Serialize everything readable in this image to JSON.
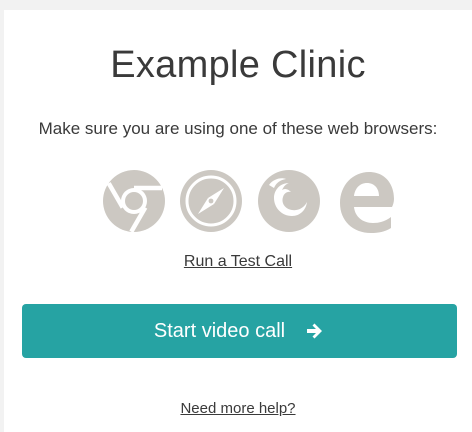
{
  "clinic": {
    "title": "Example Clinic"
  },
  "browsers": {
    "note": "Make sure you are using one of these web browsers:",
    "icons": [
      "chrome-icon",
      "safari-icon",
      "firefox-icon",
      "edge-icon"
    ],
    "icon_color": "#ccc8c2"
  },
  "links": {
    "test_call": "Run a Test Call",
    "help": "Need more help?"
  },
  "start_button": {
    "label": "Start video call",
    "icon": "arrow-right-icon",
    "color": "#26a3a3"
  }
}
